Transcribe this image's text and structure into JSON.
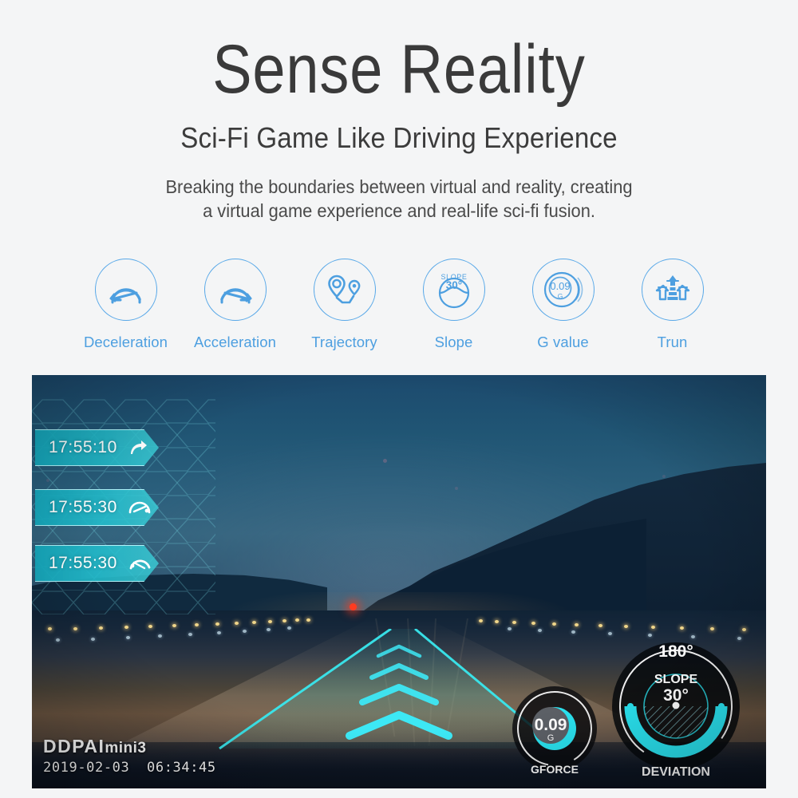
{
  "hero": {
    "title": "Sense Reality",
    "subtitle": "Sci-Fi Game Like Driving Experience",
    "desc_line1": "Breaking the boundaries between virtual and reality, creating",
    "desc_line2": "a virtual game experience and real-life sci-fi fusion."
  },
  "features": [
    {
      "label": "Deceleration",
      "icon": "deceleration-icon"
    },
    {
      "label": "Acceleration",
      "icon": "acceleration-icon"
    },
    {
      "label": "Trajectory",
      "icon": "trajectory-icon"
    },
    {
      "label": "Slope",
      "icon": "slope-icon",
      "inner_label": "SLOPE",
      "inner_value": "30°"
    },
    {
      "label": "G value",
      "icon": "g-value-icon",
      "inner_value": "0.09",
      "inner_unit": "G"
    },
    {
      "label": "Trun",
      "icon": "turn-icon"
    }
  ],
  "video": {
    "banners": [
      {
        "time": "17:55:10",
        "icon": "turn-arrow-icon"
      },
      {
        "time": "17:55:30",
        "icon": "acceleration-gauge-icon"
      },
      {
        "time": "17:55:30",
        "icon": "deceleration-gauge-icon"
      }
    ],
    "gforce_gauge": {
      "value": "0.09",
      "unit": "G",
      "label": "GFORCE"
    },
    "deviation_gauge": {
      "angle": "180°",
      "slope_label": "SLOPE",
      "slope_value": "30°",
      "label": "DEVIATION"
    },
    "watermark": {
      "brand": "DDPAI",
      "model": "mini3",
      "date": "2019-02-03",
      "time": "06:34:45"
    }
  },
  "colors": {
    "page_background": "#f4f5f6",
    "title_text": "#3a3a3a",
    "accent_blue": "#4d9fe0",
    "hud_cyan": "#23d6e6",
    "gauge_cyan": "#3de8f5"
  }
}
